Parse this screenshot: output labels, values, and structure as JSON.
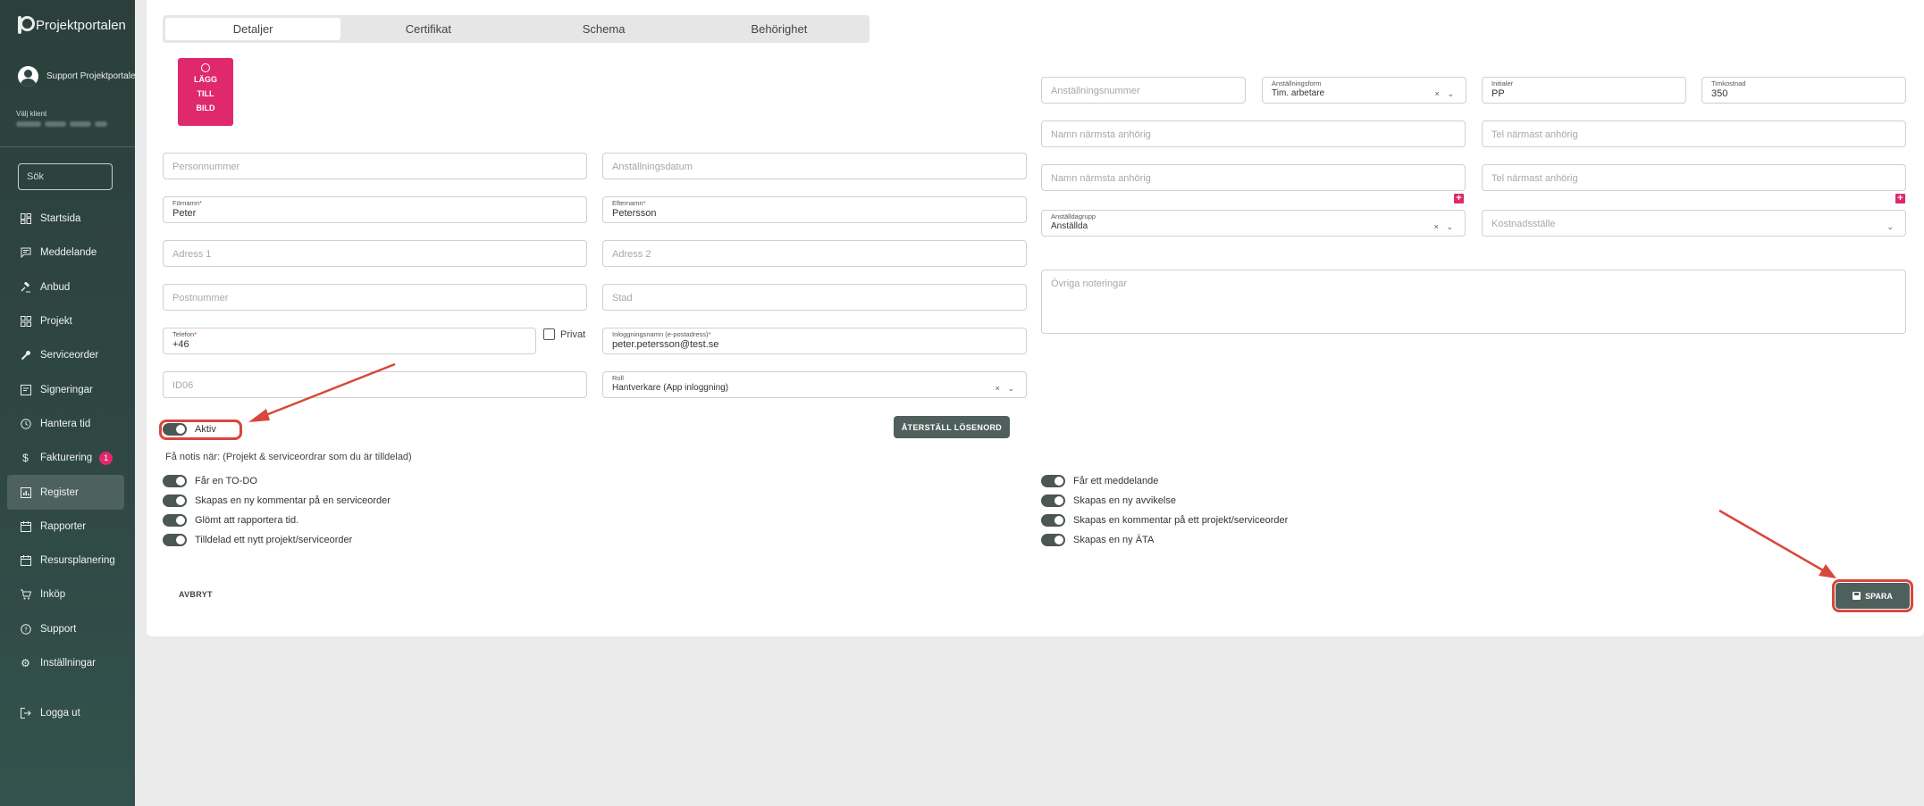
{
  "app": {
    "title": "Projektportalen"
  },
  "user": {
    "name": "Support Projektportalen"
  },
  "client": {
    "label": "Välj klient"
  },
  "search": {
    "placeholder": "Sök"
  },
  "nav": [
    {
      "label": "Startsida",
      "icon": "dashboard-icon"
    },
    {
      "label": "Meddelande",
      "icon": "message-icon"
    },
    {
      "label": "Anbud",
      "icon": "gavel-icon"
    },
    {
      "label": "Projekt",
      "icon": "grid-icon"
    },
    {
      "label": "Serviceorder",
      "icon": "wrench-icon"
    },
    {
      "label": "Signeringar",
      "icon": "signature-icon"
    },
    {
      "label": "Hantera tid",
      "icon": "clock-icon"
    },
    {
      "label": "Fakturering",
      "icon": "dollar-icon",
      "badge": "1"
    },
    {
      "label": "Register",
      "icon": "register-icon",
      "active": true
    },
    {
      "label": "Rapporter",
      "icon": "calendar-icon"
    },
    {
      "label": "Resursplanering",
      "icon": "calendar-icon"
    },
    {
      "label": "Inköp",
      "icon": "cart-icon"
    },
    {
      "label": "Support",
      "icon": "help-icon"
    },
    {
      "label": "Inställningar",
      "icon": "gear-icon"
    }
  ],
  "logout": {
    "label": "Logga ut"
  },
  "tabs": [
    "Detaljer",
    "Certifikat",
    "Schema",
    "Behörighet"
  ],
  "photo": {
    "line1": "LÄGG",
    "line2": "TILL",
    "line3": "BILD"
  },
  "form": {
    "personnummer": "Personnummer",
    "anstallningsdatum": "Anställningsdatum",
    "fornamn_label": "Förnamn",
    "fornamn": "Peter",
    "efternamn_label": "Efternamn",
    "efternamn": "Petersson",
    "adress1": "Adress 1",
    "adress2": "Adress 2",
    "postnummer": "Postnummer",
    "stad": "Stad",
    "telefon_label": "Telefon",
    "telefon": "+46",
    "privat": "Privat",
    "inlogg_label": "Inloggningsnamn (e-postadress)",
    "inlogg": "peter.petersson@test.se",
    "id06": "ID06",
    "roll_label": "Roll",
    "roll": "Hantverkare (App inloggning)",
    "anstallningsnummer": "Anställningsnummer",
    "anstallningsform_label": "Anställningsform",
    "anstallningsform": "Tim. arbetare",
    "initialer_label": "Initialer",
    "initialer": "PP",
    "timkostnad_label": "Timkostnad",
    "timkostnad": "350",
    "anhorig_namn": "Namn närmsta anhörig",
    "anhorig_tel": "Tel närmast anhörig",
    "anstalldagrupp_label": "Anställdagrupp",
    "anstalldagrupp": "Anställda",
    "kostnadsstalle": "Kostnadsställe",
    "noteringar": "Övriga noteringar",
    "clear_symbol": "×",
    "dropdown_symbol": "⌄",
    "required_mark": "*"
  },
  "aktiv": {
    "label": "Aktiv",
    "on": true
  },
  "reset_button": "ÅTERSTÄLL LÖSENORD",
  "notify": {
    "heading": "Få notis när: (Projekt & serviceordrar som du är tilldelad)",
    "left": [
      "Får en TO-DO",
      "Skapas en ny kommentar på en serviceorder",
      "Glömt att rapportera tid.",
      "Tilldelad ett nytt projekt/serviceorder"
    ],
    "right": [
      "Får ett meddelande",
      "Skapas en ny avvikelse",
      "Skapas en kommentar på ett projekt/serviceorder",
      "Skapas en ny ÄTA"
    ]
  },
  "cancel_button": "AVBRYT",
  "save_button": "SPARA",
  "colors": {
    "accent": "#e0286c",
    "sidebar": "#2f4542",
    "button": "#4f605c",
    "annotation": "#d9463b"
  }
}
